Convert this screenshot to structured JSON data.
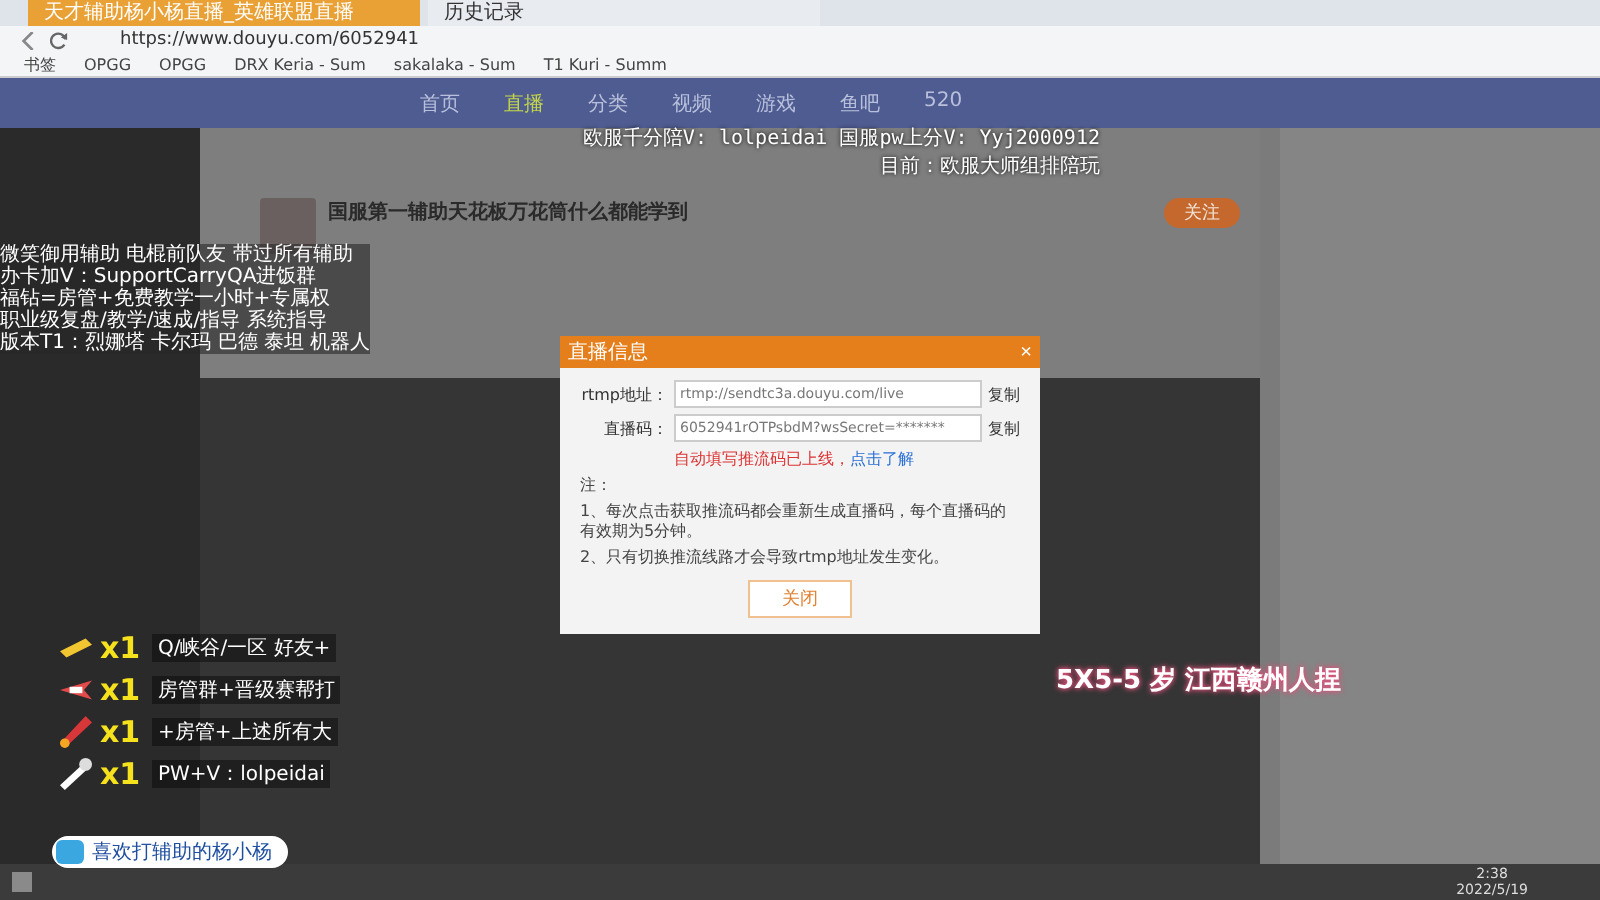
{
  "browser": {
    "tabs": [
      {
        "label": "天才辅助杨小杨直播_英雄联盟直播",
        "selected": true
      },
      {
        "label": "历史记录",
        "selected": false
      }
    ],
    "url": "https://www.douyu.com/6052941",
    "bookmarks": [
      "书签",
      "OPGG",
      "OPGG",
      "DRX Keria - Sum",
      "sakalaka - Sum",
      "T1 Kuri - Summ"
    ]
  },
  "site": {
    "nav": [
      {
        "label": "首页",
        "selected": false
      },
      {
        "label": "直播",
        "selected": true
      },
      {
        "label": "分类",
        "selected": false
      },
      {
        "label": "视频",
        "selected": false
      },
      {
        "label": "游戏",
        "selected": false
      },
      {
        "label": "鱼吧",
        "selected": false
      },
      {
        "label": "520",
        "selected": false
      }
    ],
    "room_title": "国服第一辅助天花板万花筒什么都能学到",
    "follow": "关注"
  },
  "overlay": {
    "top_lines": [
      "欧服千分陪V: lolpeidai 国服pw上分V: Yyj2000912",
      "目前：欧服大师组排陪玩"
    ],
    "left_lines": [
      "微笑御用辅助 电棍前队友 带过所有辅助",
      "办卡加V：SupportCarryQA进饭群",
      "福钻=房管+免费教学一小时+专属权",
      "职业级复盘/教学/速成/指导 系统指导",
      "版本T1：烈娜塔 卡尔玛 巴德 泰坦 机器人"
    ],
    "gifts": [
      {
        "kind": "gold",
        "count": "x1",
        "text": "Q/峡谷/一区 好友+"
      },
      {
        "kind": "plane",
        "count": "x1",
        "text": "房管群+晋级赛帮打"
      },
      {
        "kind": "rocket",
        "count": "x1",
        "text": "+房管+上述所有大"
      },
      {
        "kind": "wrench",
        "count": "x1",
        "text": "PW+V：lolpeidai"
      }
    ],
    "badge": "喜欢打辅助的杨小杨",
    "caption": "5X5-5 岁 江西赣州人捏"
  },
  "dialog": {
    "title": "直播信息",
    "close": "×",
    "fields": [
      {
        "label": "rtmp地址：",
        "value": "rtmp://sendtc3a.douyu.com/live",
        "action": "复制"
      },
      {
        "label": "直播码：",
        "value": "6052941rOTPsbdM?wsSecret=*******",
        "action": "复制"
      }
    ],
    "notice": "自动填写推流码已上线，",
    "notice_link": "点击了解",
    "notes": [
      "注：",
      "1、每次点击获取推流码都会重新生成直播码，每个直播码的有效期为5分钟。",
      "2、只有切换推流线路才会导致rtmp地址发生变化。"
    ],
    "button": "关闭"
  },
  "taskbar": {
    "time": "2:38",
    "date": "2022/5/19"
  }
}
